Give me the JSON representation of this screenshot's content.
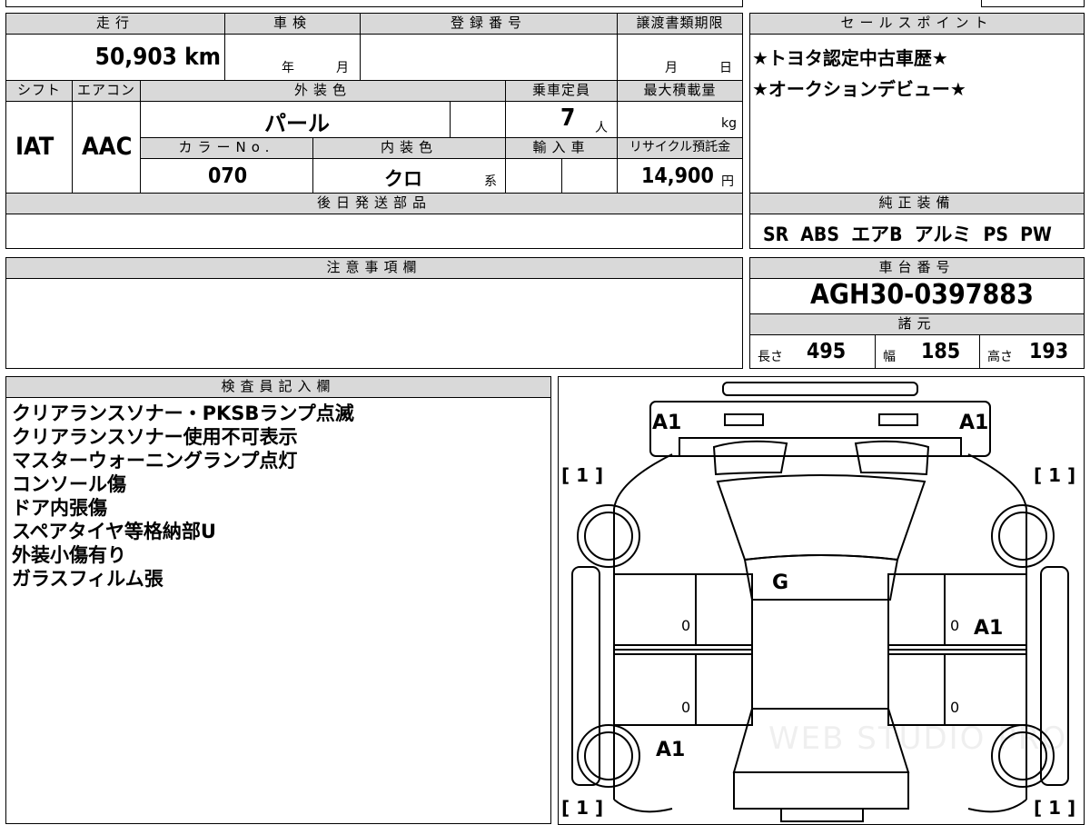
{
  "headers": {
    "mileage": "走行",
    "inspection": "車検",
    "registration": "登録番号",
    "transfer_deadline": "譲渡書類期限",
    "sales_point": "セールスポイント",
    "shift": "シフト",
    "aircon": "エアコン",
    "exterior_color": "外装色",
    "capacity": "乗車定員",
    "max_load": "最大積載量",
    "color_no": "カラーNo.",
    "interior_color": "内装色",
    "import": "輸入車",
    "recycle_fee": "リサイクル預託金",
    "later_parts": "後日発送部品",
    "genuine_equipment": "純正装備",
    "notes": "注意事項欄",
    "chassis_no": "車台番号",
    "specs": "諸元",
    "inspector": "検査員記入欄"
  },
  "values": {
    "mileage": "50,903 km",
    "inspection_year_unit": "年",
    "inspection_month_unit": "月",
    "transfer_month_unit": "月",
    "transfer_day_unit": "日",
    "shift": "IAT",
    "aircon": "AAC",
    "exterior_color": "パール",
    "capacity": "7",
    "capacity_unit": "人",
    "max_load_unit": "kg",
    "color_no": "070",
    "interior_color": "クロ",
    "interior_suffix": "系",
    "recycle_fee": "14,900",
    "recycle_unit": "円",
    "genuine_equipment": "SR  ABS  エアB  アルミ  PS  PW",
    "chassis_no": "AGH30-0397883",
    "length_label": "長さ",
    "length": "495",
    "width_label": "幅",
    "width": "185",
    "height_label": "高さ",
    "height": "193"
  },
  "sales_points": [
    "★トヨタ認定中古車歴★",
    "★オークションデビュー★"
  ],
  "inspector_notes": [
    "クリアランスソナー・PKSBランプ点滅",
    "クリアランスソナー使用不可表示",
    "マスターウォーニングランプ点灯",
    "コンソール傷",
    "ドア内張傷",
    "スペアタイヤ等格納部U",
    "外装小傷有り",
    "ガラスフィルム張"
  ],
  "diagram_marks": {
    "front_left": "A1",
    "front_right": "A1",
    "windshield": "G",
    "right_rear_door": "A1",
    "left_rear": "A1",
    "left_front_door": "0",
    "left_rear_door": "0",
    "right_front_door": "0",
    "right_rear_door_small": "0",
    "bracket_tl": "[ 1 ]",
    "bracket_tr": "[ 1 ]",
    "bracket_bl": "[ 1 ]",
    "bracket_br": "[ 1 ]"
  },
  "watermark": "WEB STUDIO PRO"
}
